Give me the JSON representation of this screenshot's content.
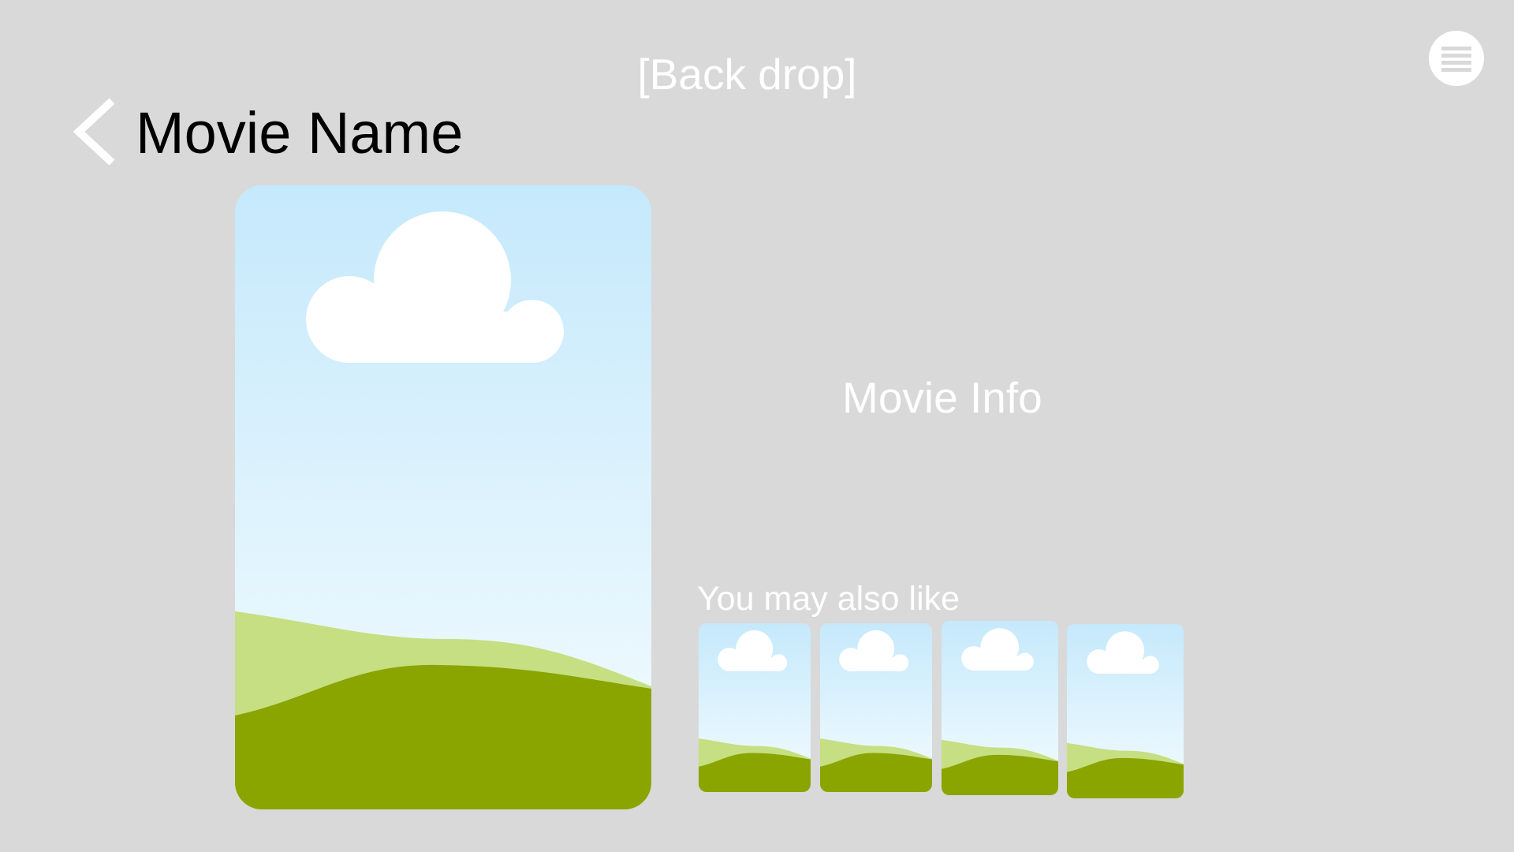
{
  "header": {
    "backdrop_label": "[Back drop]",
    "movie_name": "Movie Name"
  },
  "details": {
    "info_label": "Movie Info"
  },
  "related": {
    "section_label": "You may also like",
    "items": [
      {
        "icon": "image-placeholder-icon"
      },
      {
        "icon": "image-placeholder-icon"
      },
      {
        "icon": "image-placeholder-icon"
      },
      {
        "icon": "image-placeholder-icon"
      }
    ]
  },
  "icons": {
    "back": "chevron-left-icon",
    "menu": "hamburger-menu-icon",
    "poster": "image-placeholder-icon"
  },
  "colors": {
    "background": "#d9d9d9",
    "sky_top": "#c5e9fc",
    "sky_bottom": "#f5fcfe",
    "hill_light": "#c5df82",
    "hill_dark": "#8aa400",
    "cloud": "#ffffff"
  }
}
